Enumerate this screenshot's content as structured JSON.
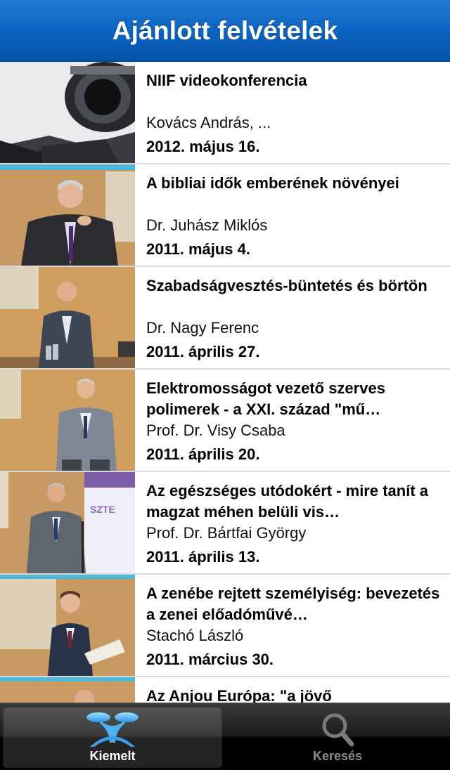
{
  "header": {
    "title": "Ajánlott felvételek"
  },
  "items": [
    {
      "title": "NIIF videokonferencia",
      "author": "Kovács András, ...",
      "date": "2012. május 16."
    },
    {
      "title": "A bibliai idők emberének növényei",
      "author": "Dr. Juhász Miklós",
      "date": "2011. május  4."
    },
    {
      "title": "Szabadságvesztés-büntetés és börtön",
      "author": "Dr. Nagy Ferenc",
      "date": "2011. április 27."
    },
    {
      "title": "Elektromosságot vezető szerves polimerek - a XXI. század \"mű…",
      "author": "Prof. Dr. Visy Csaba",
      "date": "2011. április 20."
    },
    {
      "title": "Az egészséges utódokért - mire tanít a magzat méhen belüli vis…",
      "author": "Prof. Dr. Bártfai György",
      "date": "2011. április 13."
    },
    {
      "title": "A zenébe rejtett személyiség: bevezetés a zenei előadóművé…",
      "author": "Stachó László",
      "date": "2011. március 30."
    },
    {
      "title": "Az Anjou Európa: \"a jövő",
      "author": "",
      "date": ""
    }
  ],
  "thumb_texts": {
    "szte": "SZTE"
  },
  "tabbar": {
    "tabs": [
      {
        "label": "Kiemelt",
        "icon": "featured-x-icon",
        "active": true
      },
      {
        "label": "Keresés",
        "icon": "search-icon",
        "active": false
      }
    ]
  },
  "colors": {
    "navbar": "#0a62bf",
    "tabbar": "#000000",
    "accent": "#4fb3f0"
  }
}
